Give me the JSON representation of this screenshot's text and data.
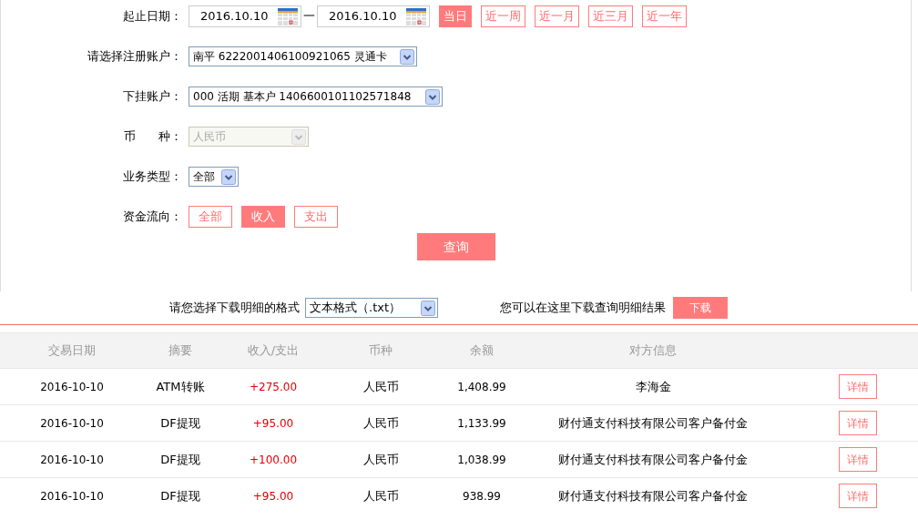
{
  "filter_form": {
    "date_range": {
      "label": "起止日期：",
      "start": "2016.10.10",
      "separator": "一",
      "end": "2016.10.10",
      "quick_ranges": [
        {
          "label": "当日",
          "selected": true
        },
        {
          "label": "近一周",
          "selected": false
        },
        {
          "label": "近一月",
          "selected": false
        },
        {
          "label": "近三月",
          "selected": false
        },
        {
          "label": "近一年",
          "selected": false
        }
      ]
    },
    "registered_account": {
      "label": "请选择注册账户：",
      "value": "南平 6222001406100921065 灵通卡",
      "disabled": false
    },
    "sub_account": {
      "label": "下挂账户：",
      "value": "000 活期 基本户 1406600101102571848",
      "disabled": false
    },
    "currency": {
      "label_left": "币",
      "label_right": "种：",
      "value": "人民币",
      "disabled": true
    },
    "business_type": {
      "label": "业务类型：",
      "value": "全部",
      "disabled": false
    },
    "fund_flow": {
      "label": "资金流向：",
      "options": [
        {
          "label": "全部",
          "selected": false
        },
        {
          "label": "收入",
          "selected": true
        },
        {
          "label": "支出",
          "selected": false
        }
      ]
    },
    "query_button": "查询"
  },
  "download": {
    "format_label": "请您选择下载明细的格式",
    "format_value": "文本格式（.txt）",
    "hint": "您可以在这里下载查询明细结果",
    "button": "下载"
  },
  "table": {
    "columns": [
      "交易日期",
      "摘要",
      "收入/支出",
      "币种",
      "余额",
      "对方信息"
    ],
    "rows": [
      {
        "date": "2016-10-10",
        "summary": "ATM转账",
        "amount": "+275.00",
        "currency": "人民币",
        "balance": "1,408.99",
        "counterparty": "李海金",
        "action": "详情"
      },
      {
        "date": "2016-10-10",
        "summary": "DF提现",
        "amount": "+95.00",
        "currency": "人民币",
        "balance": "1,133.99",
        "counterparty": "财付通支付科技有限公司客户备付金",
        "action": "详情"
      },
      {
        "date": "2016-10-10",
        "summary": "DF提现",
        "amount": "+100.00",
        "currency": "人民币",
        "balance": "1,038.99",
        "counterparty": "财付通支付科技有限公司客户备付金",
        "action": "详情"
      },
      {
        "date": "2016-10-10",
        "summary": "DF提现",
        "amount": "+95.00",
        "currency": "人民币",
        "balance": "938.99",
        "counterparty": "财付通支付科技有限公司客户备付金",
        "action": "详情"
      }
    ]
  }
}
